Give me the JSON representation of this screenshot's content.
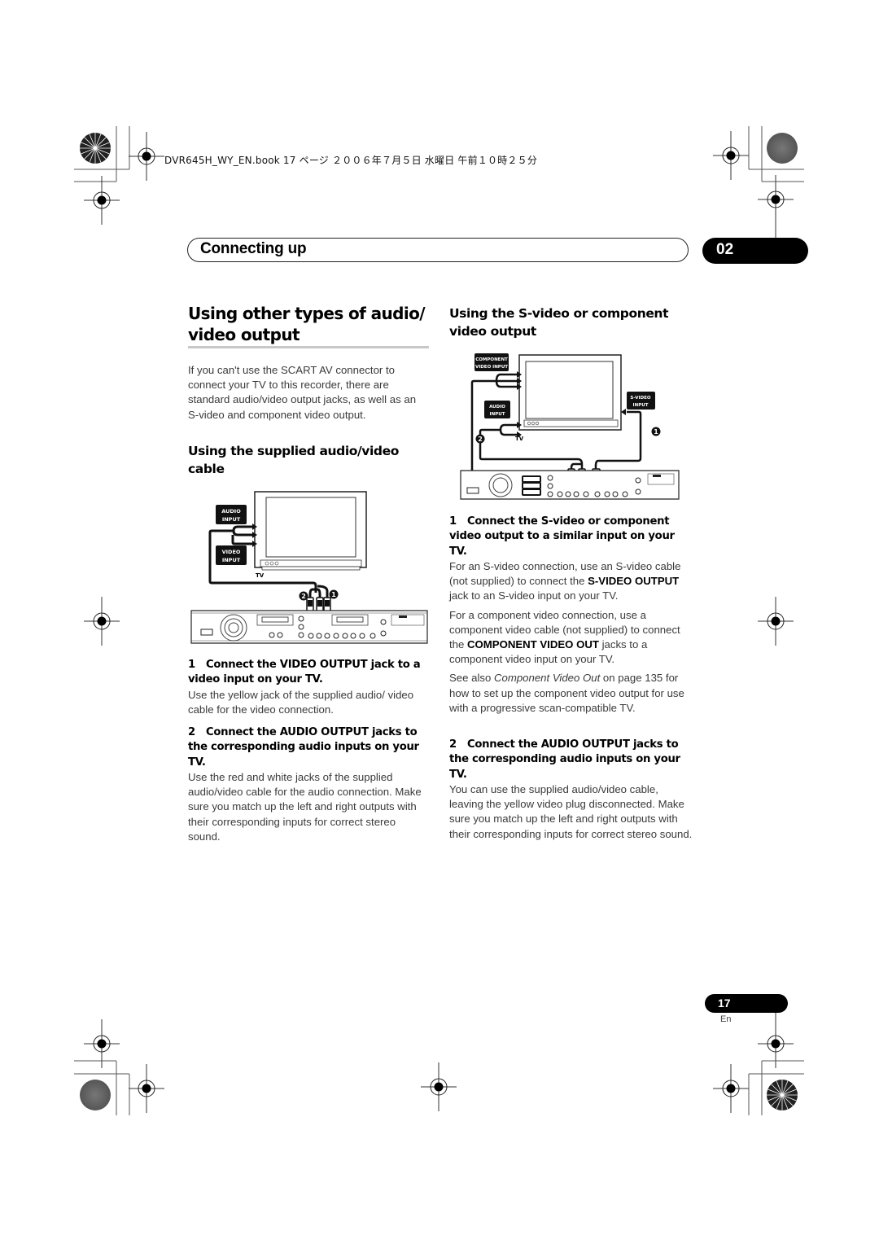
{
  "print_header": "DVR645H_WY_EN.book  17 ページ  ２００６年７月５日  水曜日  午前１０時２５分",
  "section": {
    "title": "Connecting up",
    "chapter": "02"
  },
  "left_column": {
    "heading": "Using other types of audio/ video output",
    "intro": "If you can't use the SCART AV connector to connect your TV to this recorder, there are standard audio/video output jacks, as well as an S-video and component video output.",
    "subheading": "Using the supplied audio/video cable",
    "diagram": {
      "labels": {
        "audio_input_1": "AUDIO",
        "audio_input_2": "INPUT",
        "video_input_1": "VIDEO",
        "video_input_2": "INPUT",
        "tv": "TV",
        "callout_1": "1",
        "callout_2": "2"
      }
    },
    "steps": [
      {
        "number": "1",
        "title": "Connect the VIDEO OUTPUT jack to a video input on your TV.",
        "text": "Use the yellow jack of the supplied audio/ video cable for the video connection."
      },
      {
        "number": "2",
        "title": "Connect the AUDIO OUTPUT jacks to the corresponding audio inputs on your TV.",
        "text": "Use the red and white jacks of the supplied audio/video cable for the audio connection. Make sure you match up the left and right outputs with their corresponding inputs for correct stereo sound."
      }
    ]
  },
  "right_column": {
    "subheading": "Using the S-video or component video output",
    "diagram": {
      "labels": {
        "component_1": "COMPONENT",
        "component_2": "VIDEO INPUT",
        "audio_input_1": "AUDIO",
        "audio_input_2": "INPUT",
        "svideo_input_1": "S-VIDEO",
        "svideo_input_2": "INPUT",
        "tv": "TV",
        "callout_1": "1",
        "callout_2": "2"
      }
    },
    "steps": [
      {
        "number": "1",
        "title": "Connect the S-video or component video output to a similar input on your TV.",
        "para1_a": "For an S-video connection, use an S-video cable (not supplied) to connect the ",
        "para1_bold": "S-VIDEO OUTPUT",
        "para1_b": " jack to an S-video input on your TV.",
        "para2_a": "For a component video connection, use a component video cable (not supplied) to connect the ",
        "para2_bold": "COMPONENT VIDEO OUT",
        "para2_b": " jacks to a component video input on your TV.",
        "para3_a": "See also ",
        "para3_italic": "Component Video Out",
        "para3_b": " on page 135 for how to set up the component video output for use with a progressive scan-compatible TV."
      },
      {
        "number": "2",
        "title": "Connect the AUDIO OUTPUT jacks to the corresponding audio inputs on your TV.",
        "text": "You can use the supplied audio/video cable, leaving the yellow video plug disconnected. Make sure you match up the left and right outputs with their corresponding inputs for correct stereo sound."
      }
    ]
  },
  "footer": {
    "page_number": "17",
    "language": "En"
  }
}
